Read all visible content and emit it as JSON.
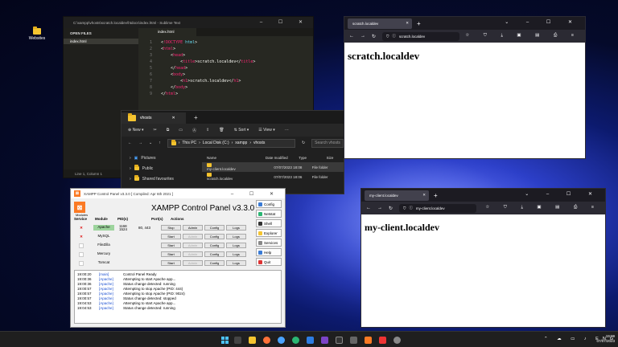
{
  "desktop": {
    "icon_label": "Websites"
  },
  "sublime": {
    "title": "C:\\xampp\\vhosts\\scratch.localdev\\htdocs\\index.html - Sublime Text",
    "sidebar_header": "OPEN FILES",
    "sidebar_file": "index.html",
    "tab": "index.html",
    "lines": [
      {
        "n": "1",
        "t": "<!DOCTYPE html>"
      },
      {
        "n": "2",
        "t": "<html>"
      },
      {
        "n": "3",
        "t": "    <head>"
      },
      {
        "n": "4",
        "t": "        <title>scratch.localdev</title>"
      },
      {
        "n": "5",
        "t": "    </head>"
      },
      {
        "n": "6",
        "t": "    <body>"
      },
      {
        "n": "7",
        "t": "        <h1>scratch.localdev</h1>"
      },
      {
        "n": "8",
        "t": "    </body>"
      },
      {
        "n": "9",
        "t": "</html>"
      }
    ],
    "status": "Line 1, Column 1"
  },
  "explorer": {
    "tab": "vhosts",
    "new_label": "New",
    "sort_label": "Sort",
    "view_label": "View",
    "address": [
      "This PC",
      "Local Disk (C:)",
      "xampp",
      "vhosts"
    ],
    "search_placeholder": "Search vhosts",
    "nav": [
      "Pictures",
      "Public",
      "Shared favourites"
    ],
    "headers": [
      "Name",
      "Date modified",
      "Type",
      "Size"
    ],
    "rows": [
      {
        "name": "my-client.localdev",
        "date": "07/07/2023 18:08",
        "type": "File folder"
      },
      {
        "name": "scratch.localdev",
        "date": "07/07/2023 18:06",
        "type": "File folder"
      }
    ]
  },
  "browser1": {
    "tab": "scratch.localdev",
    "url": "scratch.localdev",
    "heading": "scratch.localdev"
  },
  "browser2": {
    "tab": "my-client.localdev",
    "url": "my-client.localdev",
    "heading": "my-client.localdev"
  },
  "xampp": {
    "window_title": "XAMPP Control Panel v3.3.0   [ Compiled: Apr 6th 2021 ]",
    "panel_title": "XAMPP Control Panel v3.3.0",
    "modules_label": "Modules",
    "headers": {
      "service": "Service",
      "module": "Module",
      "pid": "PID(s)",
      "port": "Port(s)",
      "actions": "Actions"
    },
    "modules": [
      {
        "name": "Apache",
        "pid1": "1168",
        "pid2": "1524",
        "ports": "80, 443",
        "action": "Stop"
      },
      {
        "name": "MySQL",
        "pid1": "",
        "pid2": "",
        "ports": "",
        "action": "Start"
      },
      {
        "name": "FileZilla",
        "pid1": "",
        "pid2": "",
        "ports": "",
        "action": "Start"
      },
      {
        "name": "Mercury",
        "pid1": "",
        "pid2": "",
        "ports": "",
        "action": "Start"
      },
      {
        "name": "Tomcat",
        "pid1": "",
        "pid2": "",
        "ports": "",
        "action": "Start"
      }
    ],
    "btn_admin": "Admin",
    "btn_config": "Config",
    "btn_logs": "Logs",
    "side_buttons": [
      "Config",
      "Netstat",
      "Shell",
      "Explorer",
      "Services",
      "Help",
      "Quit"
    ],
    "log": [
      {
        "t": "19:00:20",
        "m": "[main]",
        "s": "Control Panel Ready"
      },
      {
        "t": "19:00:36",
        "m": "[Apache]",
        "s": "Attempting to start Apache app..."
      },
      {
        "t": "19:00:36",
        "m": "[Apache]",
        "s": "Status change detected: running"
      },
      {
        "t": "19:00:57",
        "m": "[Apache]",
        "s": "Attempting to stop Apache (PID: 444)"
      },
      {
        "t": "19:00:57",
        "m": "[Apache]",
        "s": "Attempting to stop Apache (PID: 9024)"
      },
      {
        "t": "19:00:57",
        "m": "[Apache]",
        "s": "Status change detected: stopped"
      },
      {
        "t": "19:04:53",
        "m": "[Apache]",
        "s": "Attempting to start Apache app..."
      },
      {
        "t": "19:04:53",
        "m": "[Apache]",
        "s": "Status change detected: running"
      }
    ]
  },
  "taskbar": {
    "time": "19:09",
    "date": "07/07/2023"
  },
  "colors": {
    "accent": "#fb7a24",
    "wallpaper": "#2c3fc8"
  }
}
